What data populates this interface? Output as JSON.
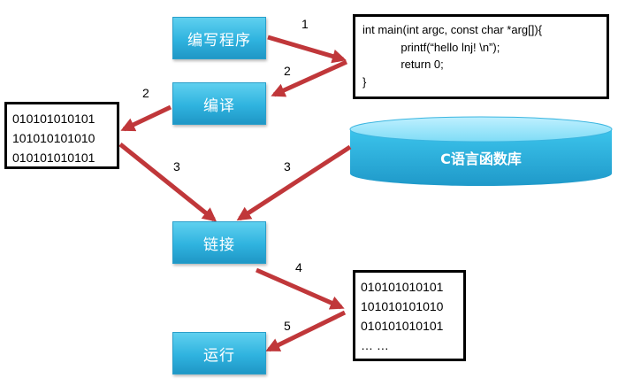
{
  "steps": {
    "write": "编写程序",
    "compile": "编译",
    "link": "链接",
    "run": "运行"
  },
  "source_code": {
    "lines": [
      "int main(int argc, const char *arg[]){",
      "            printf(“hello lnj! \\n”);",
      "            return 0;",
      "}"
    ]
  },
  "object_code": {
    "lines": [
      "010101010101",
      "101010101010",
      "010101010101"
    ]
  },
  "executable_code": {
    "lines": [
      "010101010101",
      "101010101010",
      "010101010101",
      "… …"
    ]
  },
  "library": {
    "label": "C语言函数库"
  },
  "arrow_numbers": {
    "a1": "1",
    "a2_top": "2",
    "a2_left": "2",
    "a3_left": "3",
    "a3_right": "3",
    "a4": "4",
    "a5": "5"
  },
  "colors": {
    "arrow": "#c0373a",
    "step_fill": "#2fb3df",
    "cylinder": "#2cb0dc"
  }
}
